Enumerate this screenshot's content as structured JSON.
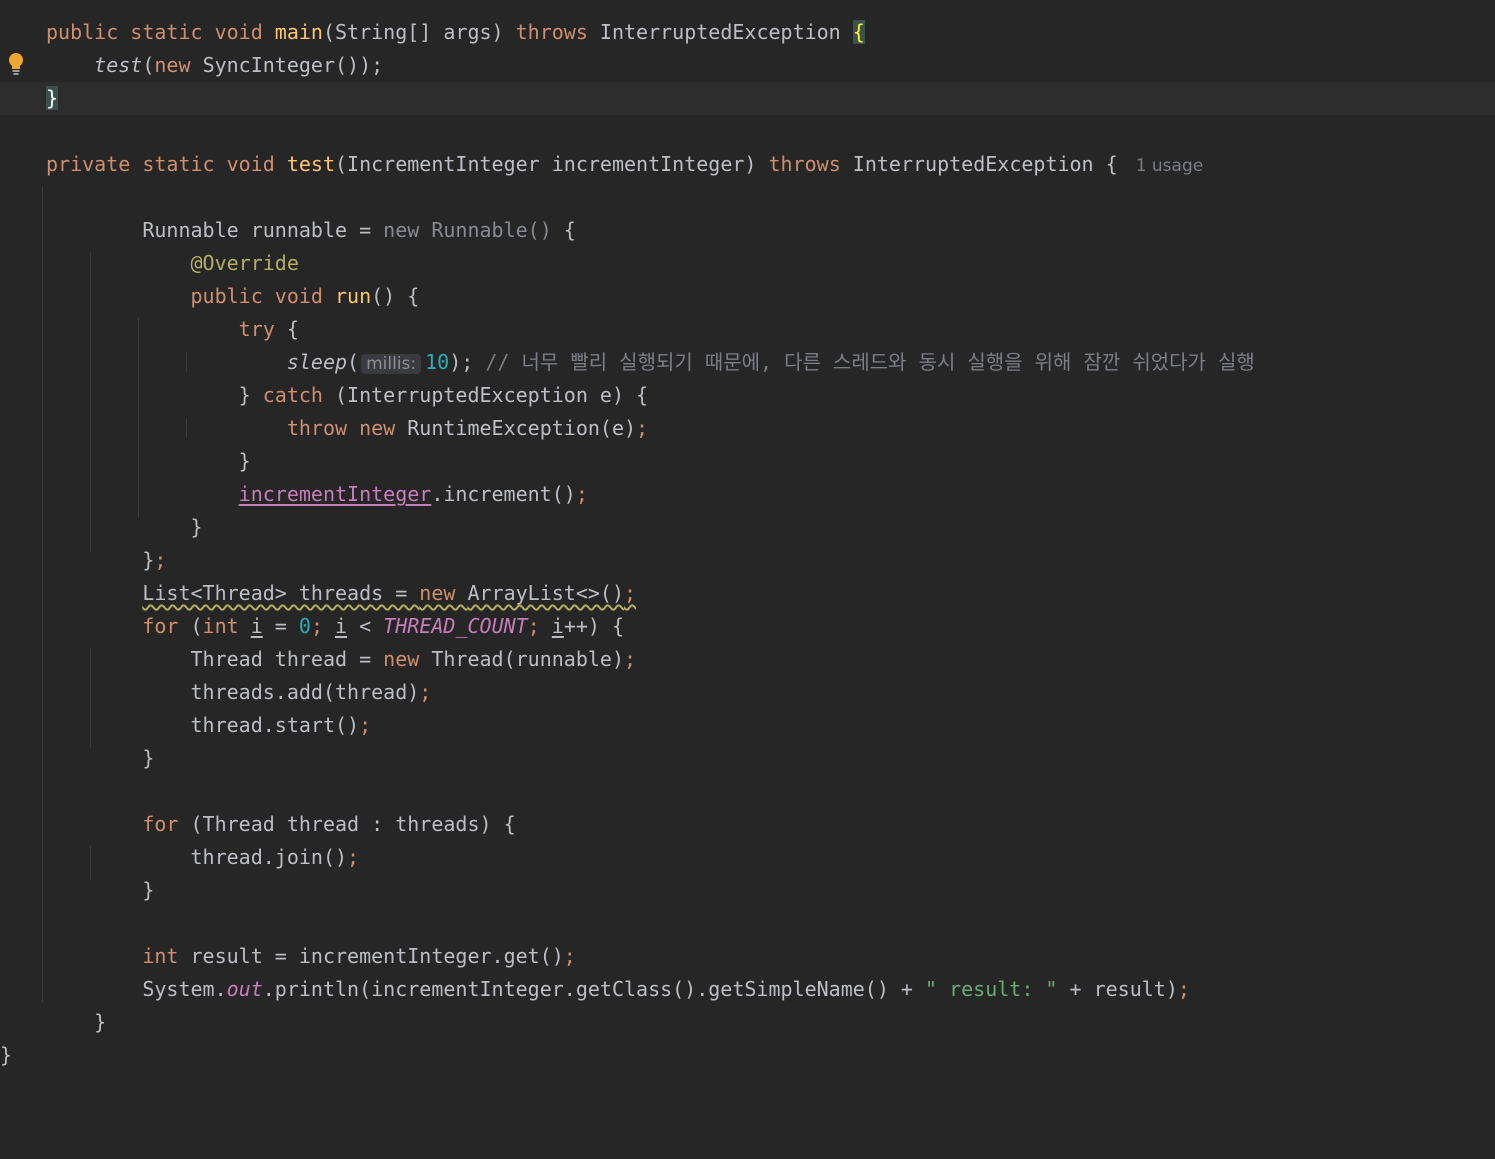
{
  "editor": {
    "lines": [
      [
        {
          "t": "public static void ",
          "c": "kw"
        },
        {
          "t": "main",
          "c": "fn-bold"
        },
        {
          "t": "(String[] args) ",
          "c": ""
        },
        {
          "t": "throws ",
          "c": "kw"
        },
        {
          "t": "InterruptedException ",
          "c": ""
        },
        {
          "t": "{",
          "c": "brace-hl"
        }
      ],
      [
        {
          "t": "    ",
          "c": ""
        },
        {
          "t": "test",
          "c": "ital"
        },
        {
          "t": "(",
          "c": ""
        },
        {
          "t": "new ",
          "c": "kw"
        },
        {
          "t": "SyncInteger());",
          "c": ""
        }
      ],
      [
        {
          "t": "}",
          "c": "brace-hl2"
        }
      ],
      [],
      [
        {
          "t": "private static void ",
          "c": "kw"
        },
        {
          "t": "test",
          "c": "fn-bold"
        },
        {
          "t": "(IncrementInteger incrementInteger) ",
          "c": ""
        },
        {
          "t": "throws ",
          "c": "kw"
        },
        {
          "t": "InterruptedException {",
          "c": ""
        },
        {
          "t": "1 usage",
          "c": "usage"
        }
      ],
      [],
      [
        {
          "t": "        Runnable runnable = ",
          "c": ""
        },
        {
          "t": "new Runnable() ",
          "c": "dim"
        },
        {
          "t": "{",
          "c": ""
        }
      ],
      [
        {
          "t": "            ",
          "c": ""
        },
        {
          "t": "@Override",
          "c": "ann"
        }
      ],
      [
        {
          "t": "            ",
          "c": ""
        },
        {
          "t": "public void ",
          "c": "kw"
        },
        {
          "t": "run",
          "c": "fn-bold"
        },
        {
          "t": "() {",
          "c": ""
        }
      ],
      [
        {
          "t": "                ",
          "c": ""
        },
        {
          "t": "try ",
          "c": "kw"
        },
        {
          "t": "{",
          "c": ""
        }
      ],
      [
        {
          "t": "                    ",
          "c": ""
        },
        {
          "t": "sleep",
          "c": "ital"
        },
        {
          "t": "(",
          "c": ""
        },
        {
          "t": "millis:",
          "c": "hint"
        },
        {
          "t": "10",
          "c": "num"
        },
        {
          "t": "); ",
          "c": ""
        },
        {
          "t": "// 너무 빨리 실행되기 때문에, 다른 스레드와 동시 실행을 위해 잠깐 쉬었다가 실행",
          "c": "cm"
        }
      ],
      [
        {
          "t": "                } ",
          "c": ""
        },
        {
          "t": "catch ",
          "c": "kw"
        },
        {
          "t": "(InterruptedException e) {",
          "c": ""
        }
      ],
      [
        {
          "t": "                    ",
          "c": ""
        },
        {
          "t": "throw new ",
          "c": "kw"
        },
        {
          "t": "RuntimeException(e)",
          "c": ""
        },
        {
          "t": ";",
          "c": "kw"
        }
      ],
      [
        {
          "t": "                }",
          "c": ""
        }
      ],
      [
        {
          "t": "                ",
          "c": ""
        },
        {
          "t": "incrementInteger",
          "c": "ul-purple"
        },
        {
          "t": ".increment()",
          "c": ""
        },
        {
          "t": ";",
          "c": "kw"
        }
      ],
      [
        {
          "t": "            }",
          "c": ""
        }
      ],
      [
        {
          "t": "        }",
          "c": ""
        },
        {
          "t": ";",
          "c": "kw"
        }
      ],
      [
        {
          "t": "        ",
          "c": ""
        },
        {
          "t": "List<Thread> threads = ",
          "c": "wavy"
        },
        {
          "t": "new ",
          "c": "kw wavy"
        },
        {
          "t": "ArrayList<>()",
          "c": "wavy"
        },
        {
          "t": ";",
          "c": "kw wavy"
        }
      ],
      [
        {
          "t": "        ",
          "c": ""
        },
        {
          "t": "for ",
          "c": "kw"
        },
        {
          "t": "(",
          "c": ""
        },
        {
          "t": "int ",
          "c": "kw"
        },
        {
          "t": "i",
          "c": "ul-u"
        },
        {
          "t": " = ",
          "c": ""
        },
        {
          "t": "0",
          "c": "num"
        },
        {
          "t": "; ",
          "c": "kw"
        },
        {
          "t": "i",
          "c": "ul-u"
        },
        {
          "t": " < ",
          "c": ""
        },
        {
          "t": "THREAD_COUNT",
          "c": "stat"
        },
        {
          "t": "; ",
          "c": "kw"
        },
        {
          "t": "i",
          "c": "ul-u"
        },
        {
          "t": "++) {",
          "c": ""
        }
      ],
      [
        {
          "t": "            Thread thread = ",
          "c": ""
        },
        {
          "t": "new ",
          "c": "kw"
        },
        {
          "t": "Thread(runnable)",
          "c": ""
        },
        {
          "t": ";",
          "c": "kw"
        }
      ],
      [
        {
          "t": "            threads.add(thread)",
          "c": ""
        },
        {
          "t": ";",
          "c": "kw"
        }
      ],
      [
        {
          "t": "            thread.start()",
          "c": ""
        },
        {
          "t": ";",
          "c": "kw"
        }
      ],
      [
        {
          "t": "        }",
          "c": ""
        }
      ],
      [],
      [
        {
          "t": "        ",
          "c": ""
        },
        {
          "t": "for ",
          "c": "kw"
        },
        {
          "t": "(Thread thread : threads) {",
          "c": ""
        }
      ],
      [
        {
          "t": "            thread.join()",
          "c": ""
        },
        {
          "t": ";",
          "c": "kw"
        }
      ],
      [
        {
          "t": "        }",
          "c": ""
        }
      ],
      [],
      [
        {
          "t": "        ",
          "c": ""
        },
        {
          "t": "int ",
          "c": "kw"
        },
        {
          "t": "result = incrementInteger.get()",
          "c": ""
        },
        {
          "t": ";",
          "c": "kw"
        }
      ],
      [
        {
          "t": "        System.",
          "c": ""
        },
        {
          "t": "out",
          "c": "stat"
        },
        {
          "t": ".println(incrementInteger.getClass().getSimpleName() + ",
          "c": ""
        },
        {
          "t": "\" result: \"",
          "c": "str"
        },
        {
          "t": " + result)",
          "c": ""
        },
        {
          "t": ";",
          "c": "kw"
        }
      ],
      [
        {
          "t": "    }",
          "c": ""
        }
      ],
      [
        {
          "t": "}",
          "c": ""
        }
      ]
    ]
  },
  "gutter": {
    "intention_icon": "lightbulb-icon"
  }
}
